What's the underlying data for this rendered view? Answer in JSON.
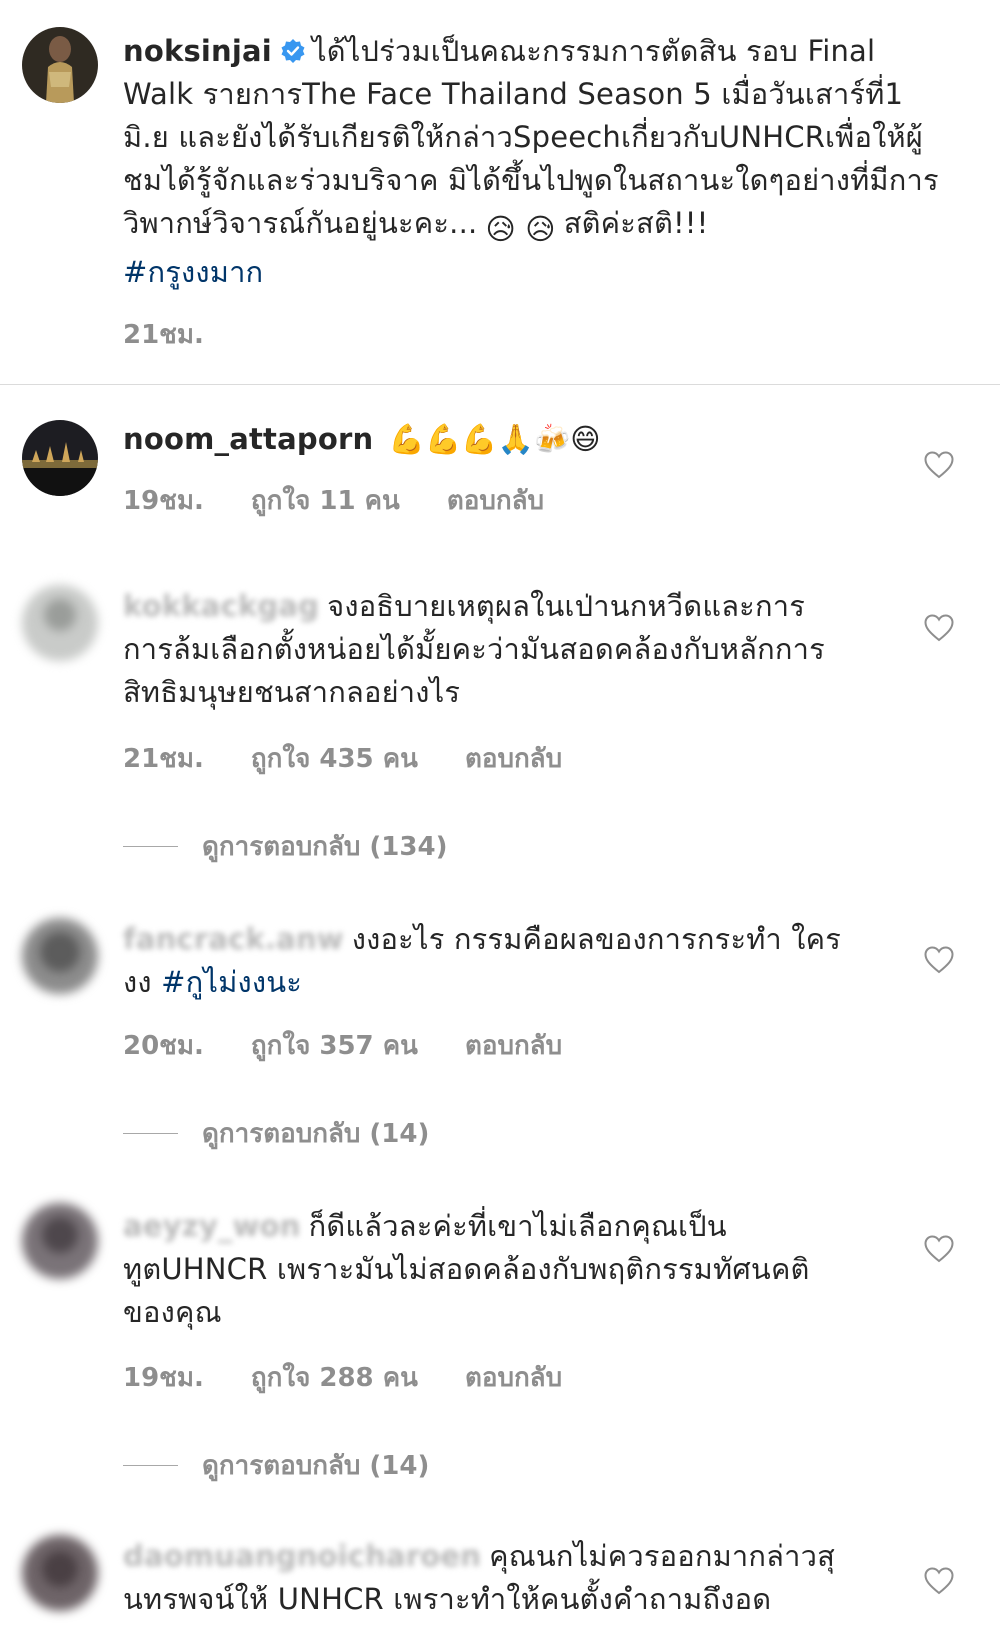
{
  "caption": {
    "username": "noksinjai",
    "text_part1": "ได้ไปร่วมเป็นคณะกรรมการตัดสิน รอบ Final Walk รายการThe Face Thailand Season 5 เมื่อวันเสาร์ที่1 มิ.ย และยังได้รับเกียรติให้กล่าวSpeechเกี่ยวกับUNHCRเพื่อให้ผู้ชมได้รู้จักและร่วมบริจาค มิได้ขึ้นไปพูดในสถานะใดๆอย่างที่มีการวิพากษ์วิจารณ์กันอยู่นะคะ...",
    "emoji": "😥 😥",
    "text_part2": "สติค่ะสติ!!!",
    "hashtag": "#กรูงงมาก",
    "time": "21ชม."
  },
  "comments": [
    {
      "username": "noom_attaporn",
      "text": "💪💪💪🙏🍻😄",
      "time": "19ชม.",
      "likes": "ถูกใจ 11 คน",
      "reply": "ตอบกลับ"
    },
    {
      "username": "kokkackgag",
      "text": "จงอธิบายเหตุผลในเป่านกหวีดและการการล้มเลือกตั้งหน่อยได้มั้ยคะว่ามันสอดคล้องกับหลักการสิทธิมนุษยชนสากลอย่างไร",
      "time": "21ชม.",
      "likes": "ถูกใจ 435 คน",
      "reply": "ตอบกลับ",
      "view_replies": "ดูการตอบกลับ (134)"
    },
    {
      "username": "fancrack.anw",
      "text": "งงอะไร กรรมคือผลของการกระทำ ใครงง",
      "hashtag": "#กูไม่งงนะ",
      "time": "20ชม.",
      "likes": "ถูกใจ 357 คน",
      "reply": "ตอบกลับ",
      "view_replies": "ดูการตอบกลับ (14)"
    },
    {
      "username": "aeyzy_won",
      "text": "ก็ดีแล้วละค่ะที่เขาไม่เลือกคุณเป็นทูตUHNCR เพราะมันไม่สอดคล้องกับพฤติกรรมทัศนคติของคุณ",
      "time": "19ชม.",
      "likes": "ถูกใจ 288 คน",
      "reply": "ตอบกลับ",
      "view_replies": "ดูการตอบกลับ (14)"
    },
    {
      "username": "daomuangnoicharoen",
      "text": "คุณนกไม่ควรออกมากล่าวสุนทรพจน์ให้ UNHCR เพราะทำให้คนตั้งคำถามถึงอด"
    }
  ]
}
